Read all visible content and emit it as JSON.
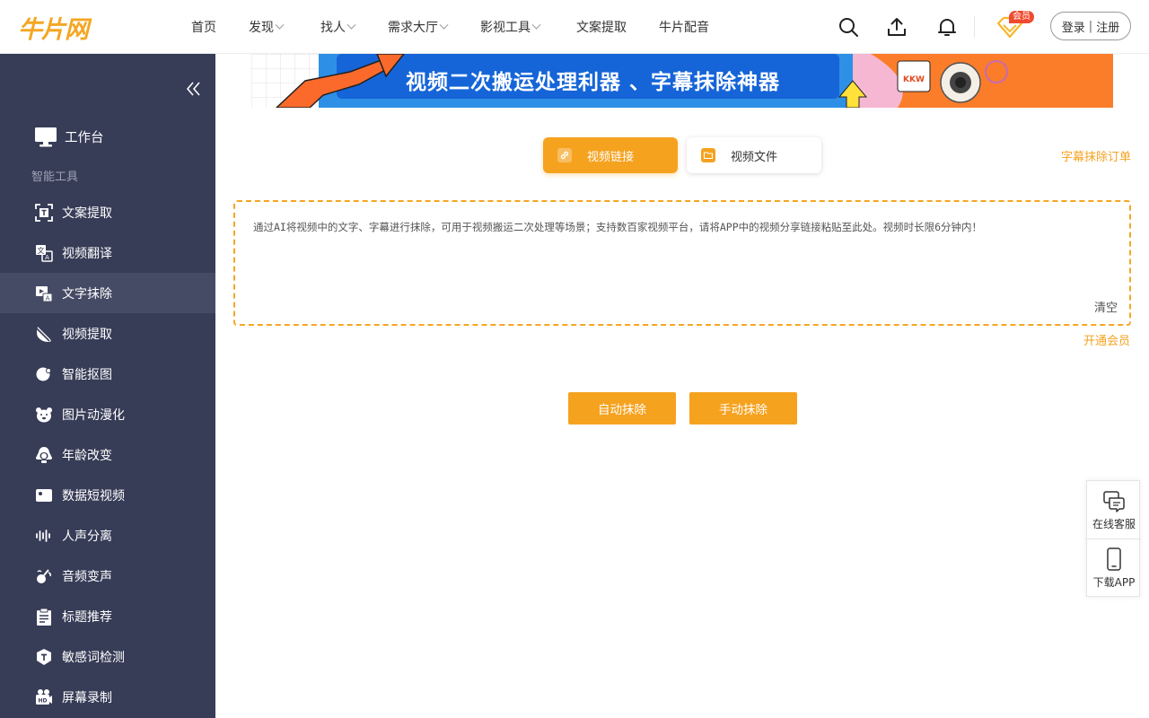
{
  "header": {
    "logo_text": "牛片网",
    "nav": [
      {
        "label": "首页",
        "has_dropdown": false
      },
      {
        "label": "发现",
        "has_dropdown": true
      },
      {
        "label": "找人",
        "has_dropdown": true
      },
      {
        "label": "需求大厅",
        "has_dropdown": true
      },
      {
        "label": "影视工具",
        "has_dropdown": true
      },
      {
        "label": "文案提取",
        "has_dropdown": false
      },
      {
        "label": "牛片配音",
        "has_dropdown": false
      }
    ],
    "icons": [
      "search-icon",
      "upload-icon",
      "bell-icon",
      "vip-diamond-icon"
    ],
    "vip_badge": "会员",
    "login_label": "登录",
    "login_sep": "|",
    "register_label": "注册"
  },
  "sidebar": {
    "workbench": {
      "label": "工作台",
      "icon": "monitor-icon"
    },
    "group_title": "智能工具",
    "items": [
      {
        "label": "文案提取",
        "icon": "scan-text-icon",
        "active": false
      },
      {
        "label": "视频翻译",
        "icon": "translate-icon",
        "active": false
      },
      {
        "label": "文字抹除",
        "icon": "erase-text-icon",
        "active": true
      },
      {
        "label": "视频提取",
        "icon": "video-extract-icon",
        "active": false
      },
      {
        "label": "智能抠图",
        "icon": "cutout-icon",
        "active": false
      },
      {
        "label": "图片动漫化",
        "icon": "bear-icon",
        "active": false
      },
      {
        "label": "年龄改变",
        "icon": "age-icon",
        "active": false
      },
      {
        "label": "数据短视频",
        "icon": "camera-icon",
        "active": false
      },
      {
        "label": "人声分离",
        "icon": "waveform-icon",
        "active": false
      },
      {
        "label": "音频变声",
        "icon": "voice-change-icon",
        "active": false
      },
      {
        "label": "标题推荐",
        "icon": "clipboard-icon",
        "active": false
      },
      {
        "label": "敏感词检测",
        "icon": "shield-text-icon",
        "active": false
      },
      {
        "label": "屏幕录制",
        "icon": "hd-record-icon",
        "active": false
      }
    ]
  },
  "banner": {
    "text": "视频二次搬运处理利器 、字幕抹除神器"
  },
  "tabs": [
    {
      "label": "视频链接",
      "icon": "link-icon",
      "active": true
    },
    {
      "label": "视频文件",
      "icon": "folder-icon",
      "active": false
    }
  ],
  "orders_link": "字幕抹除订单",
  "input": {
    "placeholder": "通过AI将视频中的文字、字幕进行抹除，可用于视频搬运二次处理等场景；支持数百家视频平台，请将APP中的视频分享链接粘贴至此处。视频时长限6分钟内！",
    "value": "",
    "clear_label": "清空"
  },
  "vip_link": "开通会员",
  "actions": {
    "auto_label": "自动抹除",
    "manual_label": "手动抹除"
  },
  "float_panel": [
    {
      "label": "在线客服",
      "icon": "chat-icon"
    },
    {
      "label": "下载APP",
      "icon": "phone-icon"
    }
  ],
  "colors": {
    "accent": "#f5a21f",
    "sidebar_bg": "#373c57",
    "sidebar_active": "#464b65"
  }
}
